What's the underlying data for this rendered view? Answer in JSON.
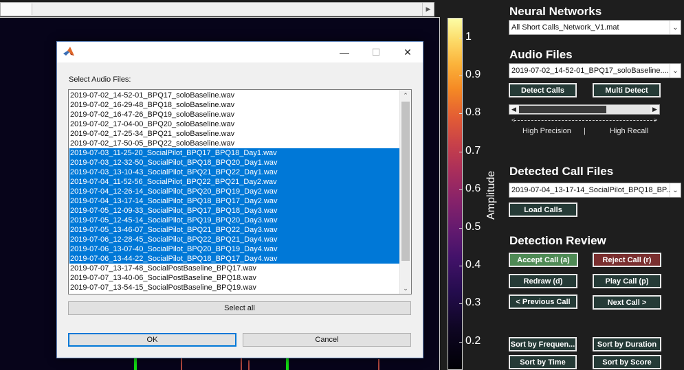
{
  "colorbar": {
    "label": "Amplitude",
    "ticks": [
      "1",
      "0.9",
      "0.8",
      "0.7",
      "0.6",
      "0.5",
      "0.4",
      "0.3",
      "0.2"
    ]
  },
  "neural_networks": {
    "title": "Neural Networks",
    "selected": "All Short Calls_Network_V1.mat"
  },
  "audio_files": {
    "title": "Audio Files",
    "selected": "2019-07-02_14-52-01_BPQ17_soloBaseline....",
    "detect_label": "Detect Calls",
    "multi_detect_label": "Multi Detect",
    "precision_label": "High Precision",
    "separator": "|",
    "recall_label": "High Recall",
    "precision_recall_level": 0.67
  },
  "detected_call_files": {
    "title": "Detected Call Files",
    "selected": "2019-07-04_13-17-14_SocialPilot_BPQ18_BP...",
    "load_label": "Load Calls"
  },
  "detection_review": {
    "title": "Detection Review",
    "accept_label": "Accept Call (a)",
    "reject_label": "Reject Call (r)",
    "redraw_label": "Redraw (d)",
    "play_label": "Play Call (p)",
    "prev_label": "< Previous Call",
    "next_label": "Next Call >",
    "sort_freq_label": "Sort by Frequen...",
    "sort_duration_label": "Sort by Duration",
    "sort_time_label": "Sort by Time",
    "sort_score_label": "Sort by Score"
  },
  "dialog": {
    "minimize": "—",
    "maximize": "☐",
    "close": "✕",
    "prompt": "Select Audio Files:",
    "files": [
      {
        "name": "2019-07-02_14-52-01_BPQ17_soloBaseline.wav",
        "selected": false
      },
      {
        "name": "2019-07-02_16-29-48_BPQ18_soloBaseline.wav",
        "selected": false
      },
      {
        "name": "2019-07-02_16-47-26_BPQ19_soloBaseline.wav",
        "selected": false
      },
      {
        "name": "2019-07-02_17-04-00_BPQ20_soloBaseline.wav",
        "selected": false
      },
      {
        "name": "2019-07-02_17-25-34_BPQ21_soloBaseline.wav",
        "selected": false
      },
      {
        "name": "2019-07-02_17-50-05_BPQ22_soloBaseline.wav",
        "selected": false
      },
      {
        "name": "2019-07-03_11-25-20_SocialPilot_BPQ17_BPQ18_Day1.wav",
        "selected": true
      },
      {
        "name": "2019-07-03_12-32-50_SocialPilot_BPQ18_BPQ20_Day1.wav",
        "selected": true
      },
      {
        "name": "2019-07-03_13-10-43_SocialPilot_BPQ21_BPQ22_Day1.wav",
        "selected": true
      },
      {
        "name": "2019-07-04_11-52-56_SocialPilot_BPQ22_BPQ21_Day2.wav",
        "selected": true
      },
      {
        "name": "2019-07-04_12-26-14_SocialPilot_BPQ20_BPQ19_Day2.wav",
        "selected": true
      },
      {
        "name": "2019-07-04_13-17-14_SocialPilot_BPQ18_BPQ17_Day2.wav",
        "selected": true
      },
      {
        "name": "2019-07-05_12-09-33_SocialPilot_BPQ17_BPQ18_Day3.wav",
        "selected": true
      },
      {
        "name": "2019-07-05_12-45-14_SocialPilot_BPQ19_BPQ20_Day3.wav",
        "selected": true
      },
      {
        "name": "2019-07-05_13-46-07_SocialPilot_BPQ21_BPQ22_Day3.wav",
        "selected": true
      },
      {
        "name": "2019-07-06_12-28-45_SocialPilot_BPQ22_BPQ21_Day4.wav",
        "selected": true
      },
      {
        "name": "2019-07-06_13-07-40_SocialPilot_BPQ20_BPQ19_Day4.wav",
        "selected": true
      },
      {
        "name": "2019-07-06_13-44-22_SocialPilot_BPQ18_BPQ17_Day4.wav",
        "selected": true
      },
      {
        "name": "2019-07-07_13-17-48_SocialPostBaseline_BPQ17.wav",
        "selected": false
      },
      {
        "name": "2019-07-07_13-40-06_SocialPostBaseline_BPQ18.wav",
        "selected": false
      },
      {
        "name": "2019-07-07_13-54-15_SocialPostBaseline_BPQ19.wav",
        "selected": false
      }
    ],
    "select_all_label": "Select all",
    "ok_label": "OK",
    "cancel_label": "Cancel"
  }
}
